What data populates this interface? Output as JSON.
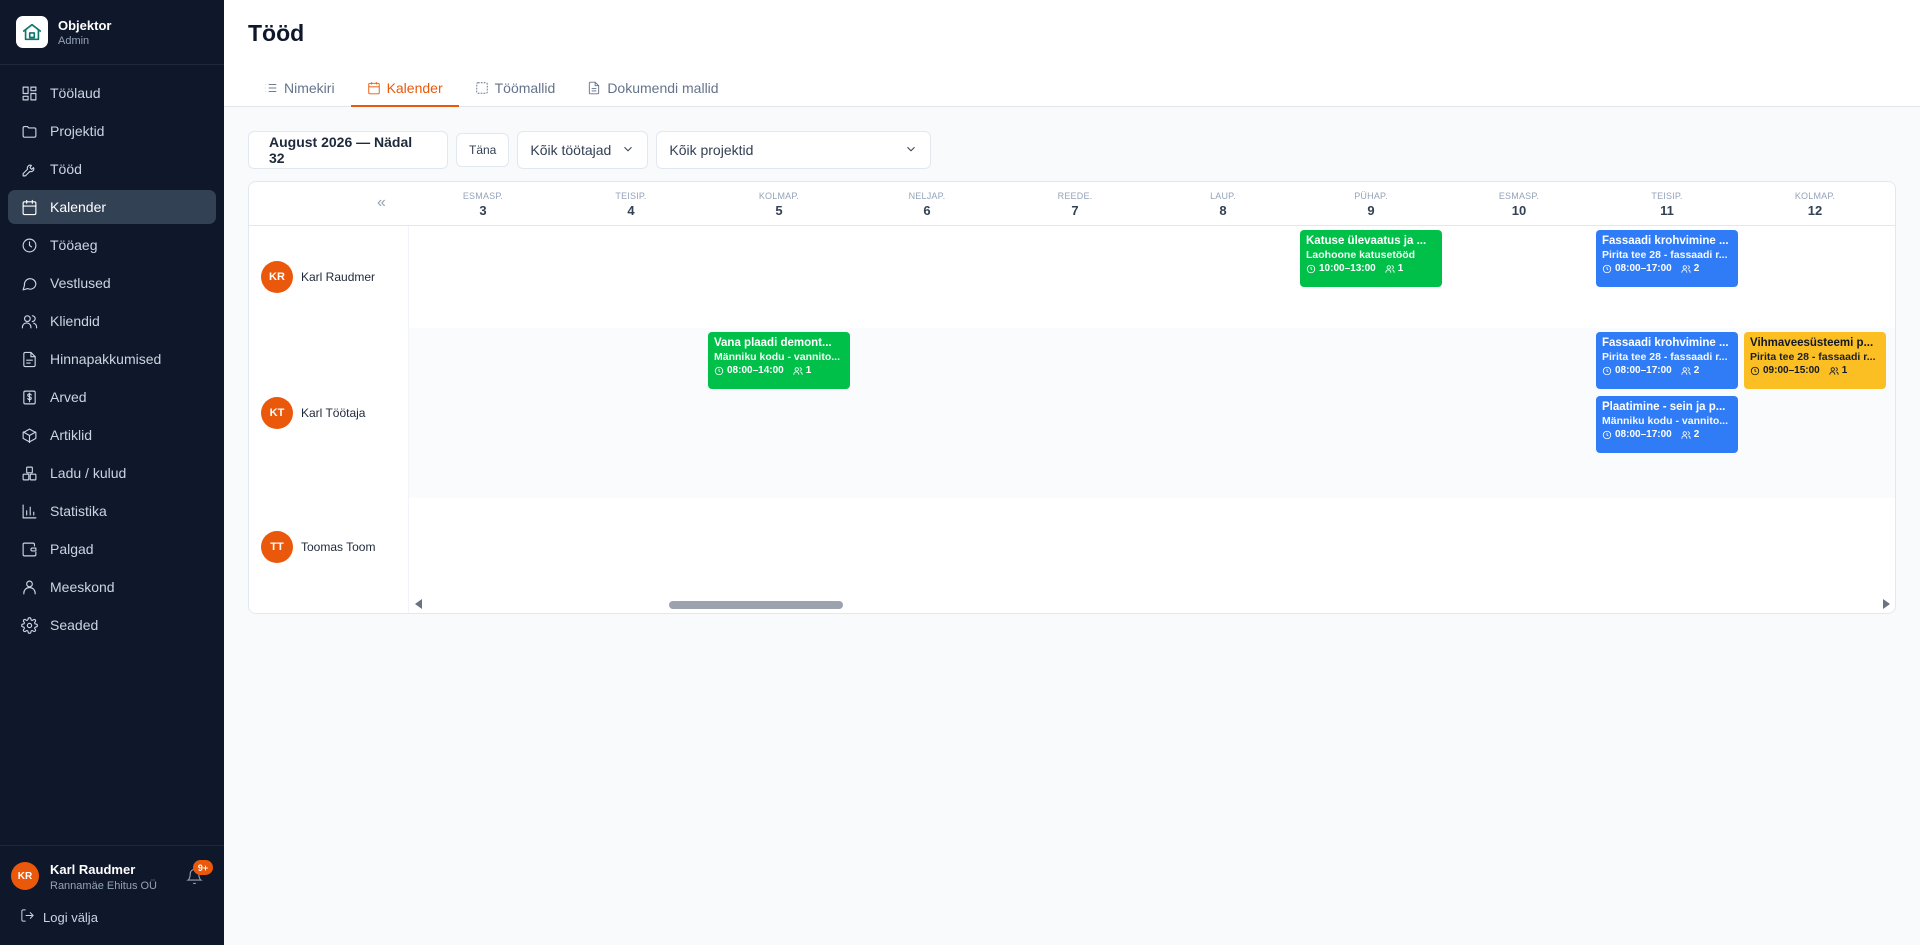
{
  "brand": {
    "name": "Objektor",
    "role": "Admin",
    "logo_icon": "house-icon"
  },
  "sidebar": {
    "items": [
      {
        "label": "Töölaud",
        "icon": "dashboard-icon",
        "active": false
      },
      {
        "label": "Projektid",
        "icon": "folder-icon",
        "active": false
      },
      {
        "label": "Tööd",
        "icon": "wrench-icon",
        "active": false
      },
      {
        "label": "Kalender",
        "icon": "calendar-icon",
        "active": true
      },
      {
        "label": "Tööaeg",
        "icon": "clock-icon",
        "active": false
      },
      {
        "label": "Vestlused",
        "icon": "chat-icon",
        "active": false
      },
      {
        "label": "Kliendid",
        "icon": "users-icon",
        "active": false
      },
      {
        "label": "Hinnapakkumised",
        "icon": "document-icon",
        "active": false
      },
      {
        "label": "Arved",
        "icon": "invoice-icon",
        "active": false
      },
      {
        "label": "Artiklid",
        "icon": "box-icon",
        "active": false
      },
      {
        "label": "Ladu / kulud",
        "icon": "boxes-icon",
        "active": false
      },
      {
        "label": "Statistika",
        "icon": "chart-icon",
        "active": false
      },
      {
        "label": "Palgad",
        "icon": "wallet-icon",
        "active": false
      },
      {
        "label": "Meeskond",
        "icon": "team-icon",
        "active": false
      },
      {
        "label": "Seaded",
        "icon": "gear-icon",
        "active": false
      }
    ]
  },
  "user": {
    "initials": "KR",
    "name": "Karl Raudmer",
    "company": "Rannamäe Ehitus OÜ",
    "notifications": "9+",
    "logout_label": "Logi välja"
  },
  "page": {
    "title": "Tööd",
    "tabs": [
      {
        "label": "Nimekiri",
        "icon": "list-icon",
        "active": false
      },
      {
        "label": "Kalender",
        "icon": "calendar-icon",
        "active": true
      },
      {
        "label": "Töömallid",
        "icon": "template-icon",
        "active": false
      },
      {
        "label": "Dokumendi mallid",
        "icon": "file-icon",
        "active": false
      }
    ]
  },
  "toolbar": {
    "week_label": "August 2026 — Nädal 32",
    "today_label": "Täna",
    "employee_filter": "Kõik töötajad",
    "project_filter": "Kõik projektid"
  },
  "calendar": {
    "collapse_label": "«",
    "days": [
      {
        "name": "ESMASP.",
        "num": "3"
      },
      {
        "name": "TEISIP.",
        "num": "4"
      },
      {
        "name": "KOLMAP.",
        "num": "5"
      },
      {
        "name": "NELJAP.",
        "num": "6"
      },
      {
        "name": "REEDE.",
        "num": "7"
      },
      {
        "name": "LAUP.",
        "num": "8"
      },
      {
        "name": "PÜHAP.",
        "num": "9"
      },
      {
        "name": "ESMASP.",
        "num": "10"
      },
      {
        "name": "TEISIP.",
        "num": "11"
      },
      {
        "name": "KOLMAP.",
        "num": "12"
      }
    ],
    "employees": [
      {
        "initials": "KR",
        "name": "Karl Raudmer"
      },
      {
        "initials": "KT",
        "name": "Karl Töötaja"
      },
      {
        "initials": "TT",
        "name": "Toomas Toom"
      }
    ],
    "colors": {
      "green": "#00c04a",
      "blue": "#2f7cf6",
      "amber": "#fbbf24",
      "avatar": "#ea580c",
      "accent": "#ea580c"
    },
    "events": [
      {
        "employee": 0,
        "day": 6,
        "slot": 0,
        "color": "green",
        "title": "Katuse ülevaatus ja ...",
        "subtitle": "Laohoone katusetööd",
        "time": "10:00–13:00",
        "count": "1"
      },
      {
        "employee": 0,
        "day": 8,
        "slot": 0,
        "color": "blue",
        "title": "Fassaadi krohvimine ...",
        "subtitle": "Pirita tee 28 - fassaadi r...",
        "time": "08:00–17:00",
        "count": "2"
      },
      {
        "employee": 1,
        "day": 2,
        "slot": 0,
        "color": "green",
        "title": "Vana plaadi demont...",
        "subtitle": "Männiku kodu - vannito...",
        "time": "08:00–14:00",
        "count": "1"
      },
      {
        "employee": 1,
        "day": 8,
        "slot": 0,
        "color": "blue",
        "title": "Fassaadi krohvimine ...",
        "subtitle": "Pirita tee 28 - fassaadi r...",
        "time": "08:00–17:00",
        "count": "2"
      },
      {
        "employee": 1,
        "day": 9,
        "slot": 0,
        "color": "amber",
        "title": "Vihmaveesüsteemi p...",
        "subtitle": "Pirita tee 28 - fassaadi r...",
        "time": "09:00–15:00",
        "count": "1"
      },
      {
        "employee": 1,
        "day": 8,
        "slot": 1,
        "color": "blue",
        "title": "Plaatimine - sein ja p...",
        "subtitle": "Männiku kodu - vannito...",
        "time": "08:00–17:00",
        "count": "2"
      }
    ]
  }
}
